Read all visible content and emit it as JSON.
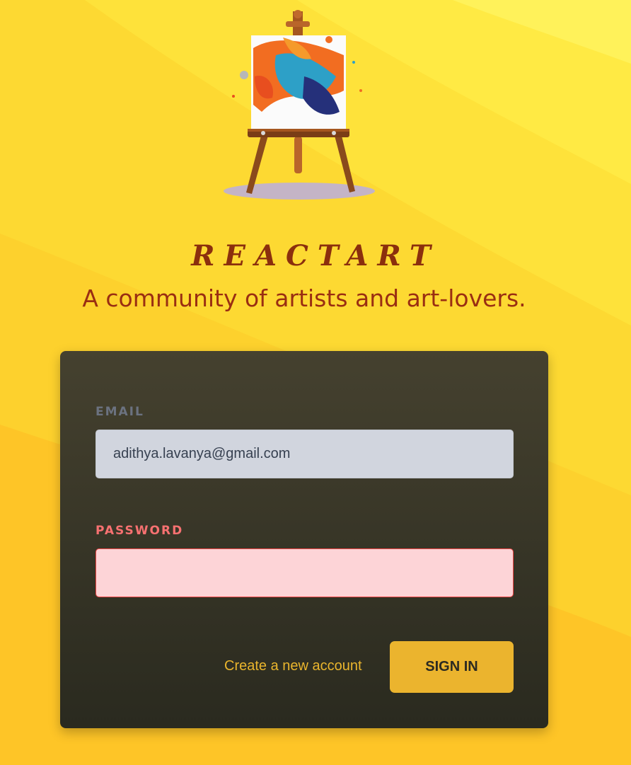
{
  "brand": {
    "name": "REACTART",
    "tagline": "A community of artists and art-lovers."
  },
  "login_form": {
    "email_label": "EMAIL",
    "email_value": "adithya.lavanya@gmail.com",
    "password_label": "PASSWORD",
    "password_value": "",
    "create_account_label": "Create a new account",
    "sign_in_label": "SIGN IN"
  },
  "colors": {
    "background": "#fdd62e",
    "brand_text": "#8b2f0d",
    "card": "#3a382a",
    "accent": "#ebb42e",
    "error": "#ef4444"
  },
  "icons": {
    "logo": "easel-painting-icon"
  }
}
